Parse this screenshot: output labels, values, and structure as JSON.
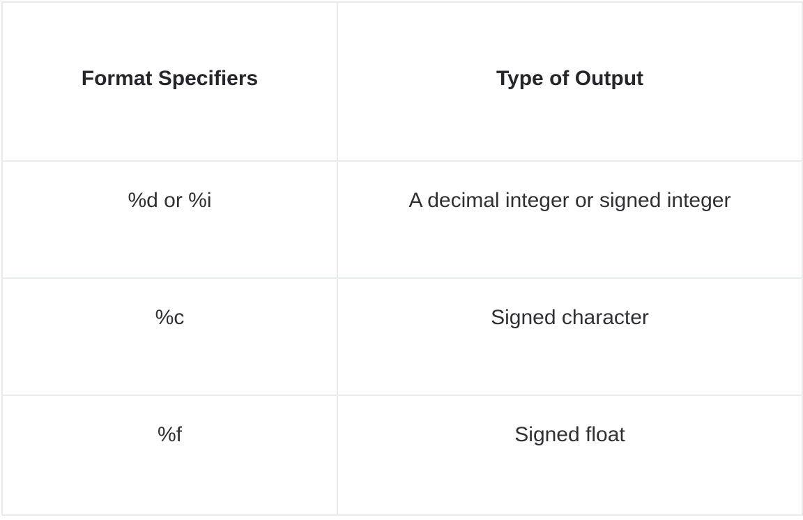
{
  "table": {
    "headers": [
      "Format Specifiers",
      "Type of Output"
    ],
    "rows": [
      [
        "%d or %i",
        "A decimal integer or signed integer"
      ],
      [
        "%c",
        "Signed character"
      ],
      [
        "%f",
        "Signed float"
      ]
    ]
  },
  "colors": {
    "border": "#e6ecec",
    "text": "#26282b",
    "background": "#ffffff"
  }
}
